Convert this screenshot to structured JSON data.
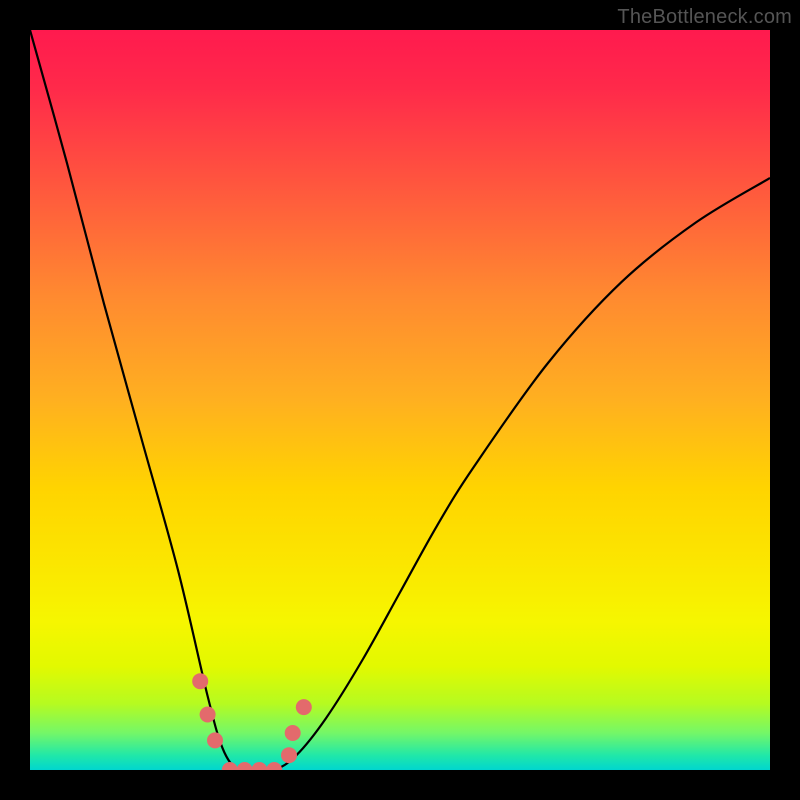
{
  "watermark": "TheBottleneck.com",
  "chart_data": {
    "type": "line",
    "title": "",
    "xlabel": "",
    "ylabel": "",
    "xlim": [
      0,
      1
    ],
    "ylim": [
      0,
      1
    ],
    "series": [
      {
        "name": "bottleneck-curve",
        "x": [
          0.0,
          0.05,
          0.1,
          0.15,
          0.2,
          0.24,
          0.26,
          0.28,
          0.3,
          0.33,
          0.36,
          0.4,
          0.45,
          0.5,
          0.55,
          0.6,
          0.7,
          0.8,
          0.9,
          1.0
        ],
        "values": [
          1.0,
          0.82,
          0.63,
          0.45,
          0.27,
          0.1,
          0.03,
          0.0,
          0.0,
          0.0,
          0.02,
          0.07,
          0.15,
          0.24,
          0.33,
          0.41,
          0.55,
          0.66,
          0.74,
          0.8
        ]
      }
    ],
    "markers": {
      "name": "highlight-dots",
      "x": [
        0.23,
        0.24,
        0.25,
        0.27,
        0.29,
        0.31,
        0.33,
        0.35,
        0.355,
        0.37
      ],
      "values": [
        0.12,
        0.075,
        0.04,
        0.0,
        0.0,
        0.0,
        0.0,
        0.02,
        0.05,
        0.085
      ]
    },
    "colors": {
      "curve": "#000000",
      "marker": "#e36a6c"
    }
  }
}
